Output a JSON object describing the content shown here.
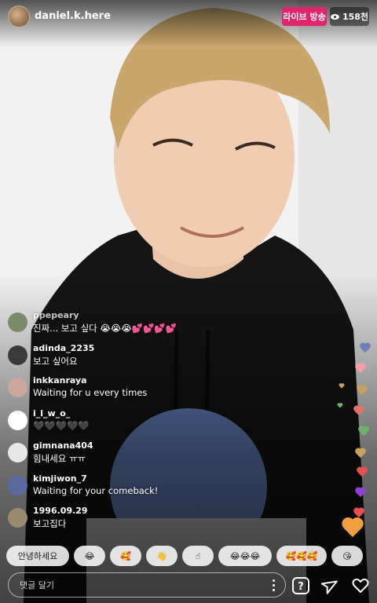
{
  "header": {
    "username": "daniel.k.here",
    "live_label": "라이브 방송",
    "viewers": "158천"
  },
  "comments": [
    {
      "user": "ppepeary",
      "text": "진짜... 보고 싶다 😭😭😭💕💕💕💕",
      "avatar_color": "#7a8b6a"
    },
    {
      "user": "adinda_2235",
      "text": "보고 싶어요",
      "avatar_color": "#3a3a3a"
    },
    {
      "user": "inkkanraya",
      "text": "Waiting for u every times",
      "avatar_color": "#c9a79a"
    },
    {
      "user": "i_l_w_o_",
      "text": "🖤🖤🖤🖤🖤",
      "avatar_color": "#ffffff"
    },
    {
      "user": "gimnana404",
      "text": "힘내세요 ㅠㅠ",
      "avatar_color": "#e8e8e8"
    },
    {
      "user": "kimjiwon_7",
      "text": "Waiting for your comeback!",
      "avatar_color": "#5a6aa0"
    },
    {
      "user": "1996.09.29",
      "text": "보고집다",
      "avatar_color": "#9a8a70"
    }
  ],
  "quick_replies": [
    "안녕하세요",
    "😂",
    "🥰",
    "👋",
    "☝",
    "😂😂😂",
    "🥰🥰🥰",
    "😘"
  ],
  "comment_placeholder": "댓글 달기",
  "colors": {
    "live": "#e0256c",
    "hearts": [
      "#6e7fb8",
      "#e06a9a",
      "#f0a0a8",
      "#c8a060",
      "#e07070",
      "#70b070",
      "#e85050",
      "#9040d0",
      "#f0a040",
      "#a0a0e0"
    ]
  }
}
